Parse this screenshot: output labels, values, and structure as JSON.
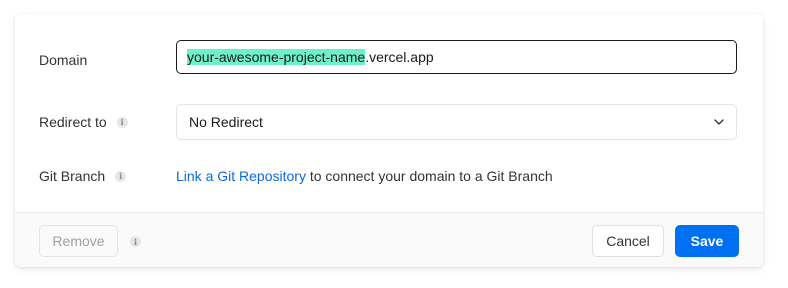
{
  "domain": {
    "label": "Domain",
    "value_highlighted": "your-awesome-project-name",
    "value_suffix": ".vercel.app"
  },
  "redirect": {
    "label": "Redirect to",
    "info_icon": "info-icon",
    "selected": "No Redirect",
    "dropdown_icon": "chevron-down-icon"
  },
  "git_branch": {
    "label": "Git Branch",
    "info_icon": "info-icon",
    "link_text": "Link a Git Repository",
    "suffix_text": " to connect your domain to a Git Branch"
  },
  "footer": {
    "remove_label": "Remove",
    "info_icon": "info-icon",
    "cancel_label": "Cancel",
    "save_label": "Save"
  },
  "colors": {
    "accent": "#0070f3",
    "link": "#0a6be0",
    "highlight": "#6ef0c8"
  }
}
